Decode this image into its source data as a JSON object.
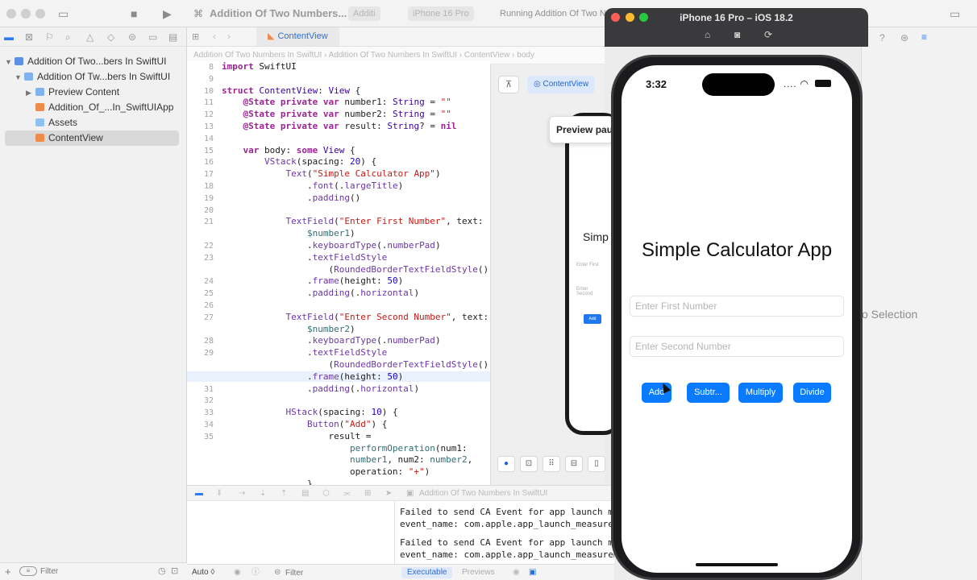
{
  "xcode": {
    "window_title": "Addition Of Two Numbers...",
    "tab_scheme": "Additi",
    "tab_device": "iPhone 16 Pro",
    "run_status": "Running Addition Of Two Nu",
    "project_tree": [
      {
        "label": "Addition Of Two...bers In SwiftUI"
      },
      {
        "label": "Addition Of Tw...bers In SwiftUI"
      },
      {
        "label": "Preview Content"
      },
      {
        "label": "Addition_Of_...In_SwiftUIApp"
      },
      {
        "label": "Assets"
      },
      {
        "label": "ContentView"
      }
    ],
    "nav_filter_placeholder": "Filter",
    "editor_tab": "ContentView",
    "jumpbar": "Addition Of Two Numbers In SwiftUI  ›  Addition Of Two Numbers In SwiftUI  ›  ContentView  ›  body",
    "line_numbers": [
      "8",
      "9",
      "10",
      "11",
      "12",
      "13",
      "14",
      "15",
      "16",
      "17",
      "18",
      "19",
      "20",
      "21",
      "",
      "22",
      "23",
      "",
      "24",
      "25",
      "26",
      "27",
      "",
      "28",
      "29",
      "",
      "30",
      "31",
      "32",
      "33",
      "34",
      "35",
      "",
      "",
      ""
    ],
    "canvas": {
      "chip_label": "ContentView",
      "paused_label": "Preview paus",
      "mini_title": "Simp",
      "mini_field1": "Enter First",
      "mini_field2": "Enter Second",
      "mini_add": "Add"
    },
    "debug_bar_label": "Addition Of Two Numbers In SwiftUI",
    "console_logs": [
      "Failed to send CA Event for app launch me\nevent_name: com.apple.app_launch_measurem",
      "Failed to send CA Event for app launch me\nevent_name: com.apple.app_launch_measurem"
    ],
    "footer": {
      "auto_label": "Auto ◊",
      "filter_placeholder": "Filter",
      "executable_label": "Executable",
      "previews_label": "Previews"
    },
    "inspector_text": "o Selection"
  },
  "simulator": {
    "title": "iPhone 16 Pro – iOS 18.2",
    "status_time": "3:32",
    "app_title": "Simple Calculator App",
    "field1_placeholder": "Enter First Number",
    "field2_placeholder": "Enter Second Number",
    "buttons": {
      "add": "Add",
      "subtract": "Subtr...",
      "multiply": "Multiply",
      "divide": "Divide"
    }
  },
  "colors": {
    "accent_blue": "#0a7bff",
    "traffic_red": "#ff5f57",
    "traffic_yellow": "#febc2e",
    "traffic_green": "#28c840"
  }
}
